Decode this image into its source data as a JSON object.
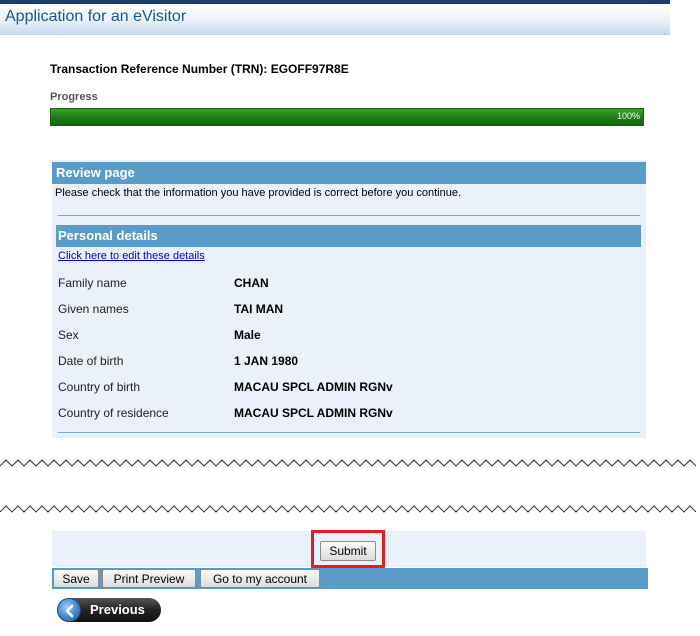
{
  "header": {
    "title": "Application for an eVisitor"
  },
  "trn": {
    "text": "Transaction Reference Number (TRN): EGOFF97R8E"
  },
  "progress": {
    "label": "Progress",
    "percent_text": "100%",
    "value": 100
  },
  "review": {
    "heading": "Review page",
    "intro": "Please check that the information you have provided is correct before you continue."
  },
  "personal": {
    "heading": "Personal details",
    "edit_link": "Click here to edit these details",
    "fields": [
      {
        "label": "Family name",
        "value": "CHAN"
      },
      {
        "label": "Given names",
        "value": "TAI MAN"
      },
      {
        "label": "Sex",
        "value": "Male"
      },
      {
        "label": "Date of birth",
        "value": "1 JAN 1980"
      },
      {
        "label": "Country of birth",
        "value": "MACAU SPCL ADMIN RGNv"
      },
      {
        "label": "Country of residence",
        "value": "MACAU SPCL ADMIN RGNv"
      }
    ]
  },
  "actions": {
    "submit": "Submit",
    "save": "Save",
    "print_preview": "Print Preview",
    "go_to_account": "Go to my account",
    "previous": "Previous"
  },
  "colors": {
    "header_text": "#1d5597",
    "panel_heading_bg": "#5b9bc8",
    "panel_bg": "#eaf1fa",
    "progress_fill": "#1f7f17",
    "highlight": "#e41b23"
  }
}
